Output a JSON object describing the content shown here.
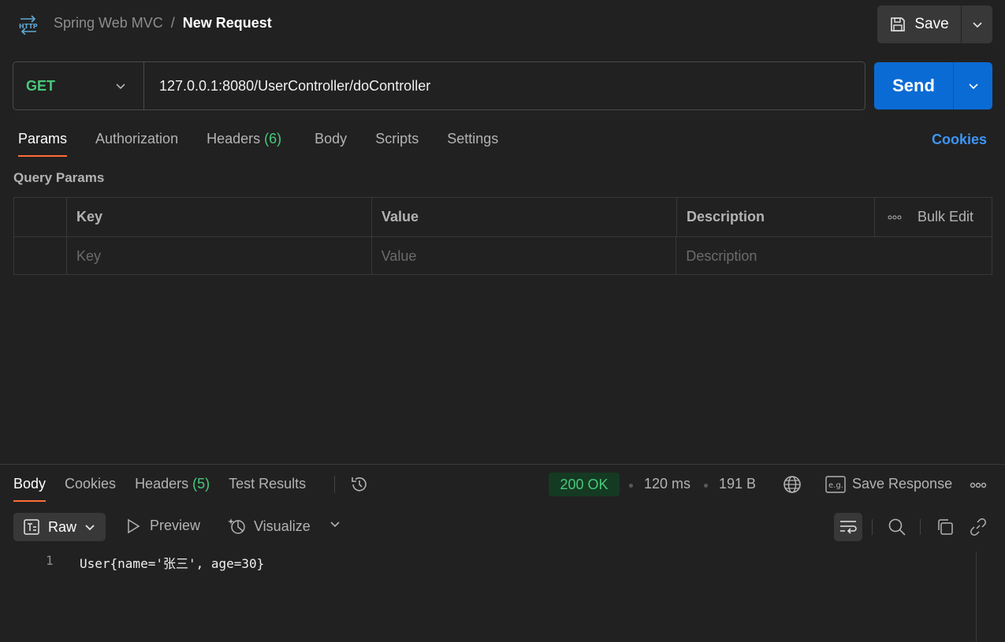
{
  "header": {
    "collection": "Spring Web MVC",
    "separator": "/",
    "request_name": "New Request",
    "save_label": "Save"
  },
  "request": {
    "method": "GET",
    "url": "127.0.0.1:8080/UserController/doController",
    "send_label": "Send"
  },
  "request_tabs": {
    "params": "Params",
    "authorization": "Authorization",
    "headers": "Headers",
    "headers_count": "(6)",
    "body": "Body",
    "scripts": "Scripts",
    "settings": "Settings",
    "cookies_link": "Cookies"
  },
  "query_params": {
    "title": "Query Params",
    "columns": {
      "key": "Key",
      "value": "Value",
      "description": "Description",
      "bulk_edit": "Bulk Edit"
    },
    "placeholders": {
      "key": "Key",
      "value": "Value",
      "description": "Description"
    }
  },
  "response": {
    "tabs": {
      "body": "Body",
      "cookies": "Cookies",
      "headers": "Headers",
      "headers_count": "(5)",
      "test_results": "Test Results"
    },
    "status": "200 OK",
    "time": "120 ms",
    "size": "191 B",
    "save_response": "Save Response",
    "view_modes": {
      "raw": "Raw",
      "preview": "Preview",
      "visualize": "Visualize"
    },
    "lines": [
      {
        "number": "1",
        "text": "User{name='张三', age=30}"
      }
    ]
  },
  "colors": {
    "background": "#212121",
    "method_get": "#47c97a",
    "send_button": "#0b6bd4",
    "active_tab_underline": "#ff6c37",
    "link_blue": "#3d96f5",
    "status_ok_bg": "#153a23",
    "status_ok_text": "#47c97a"
  }
}
